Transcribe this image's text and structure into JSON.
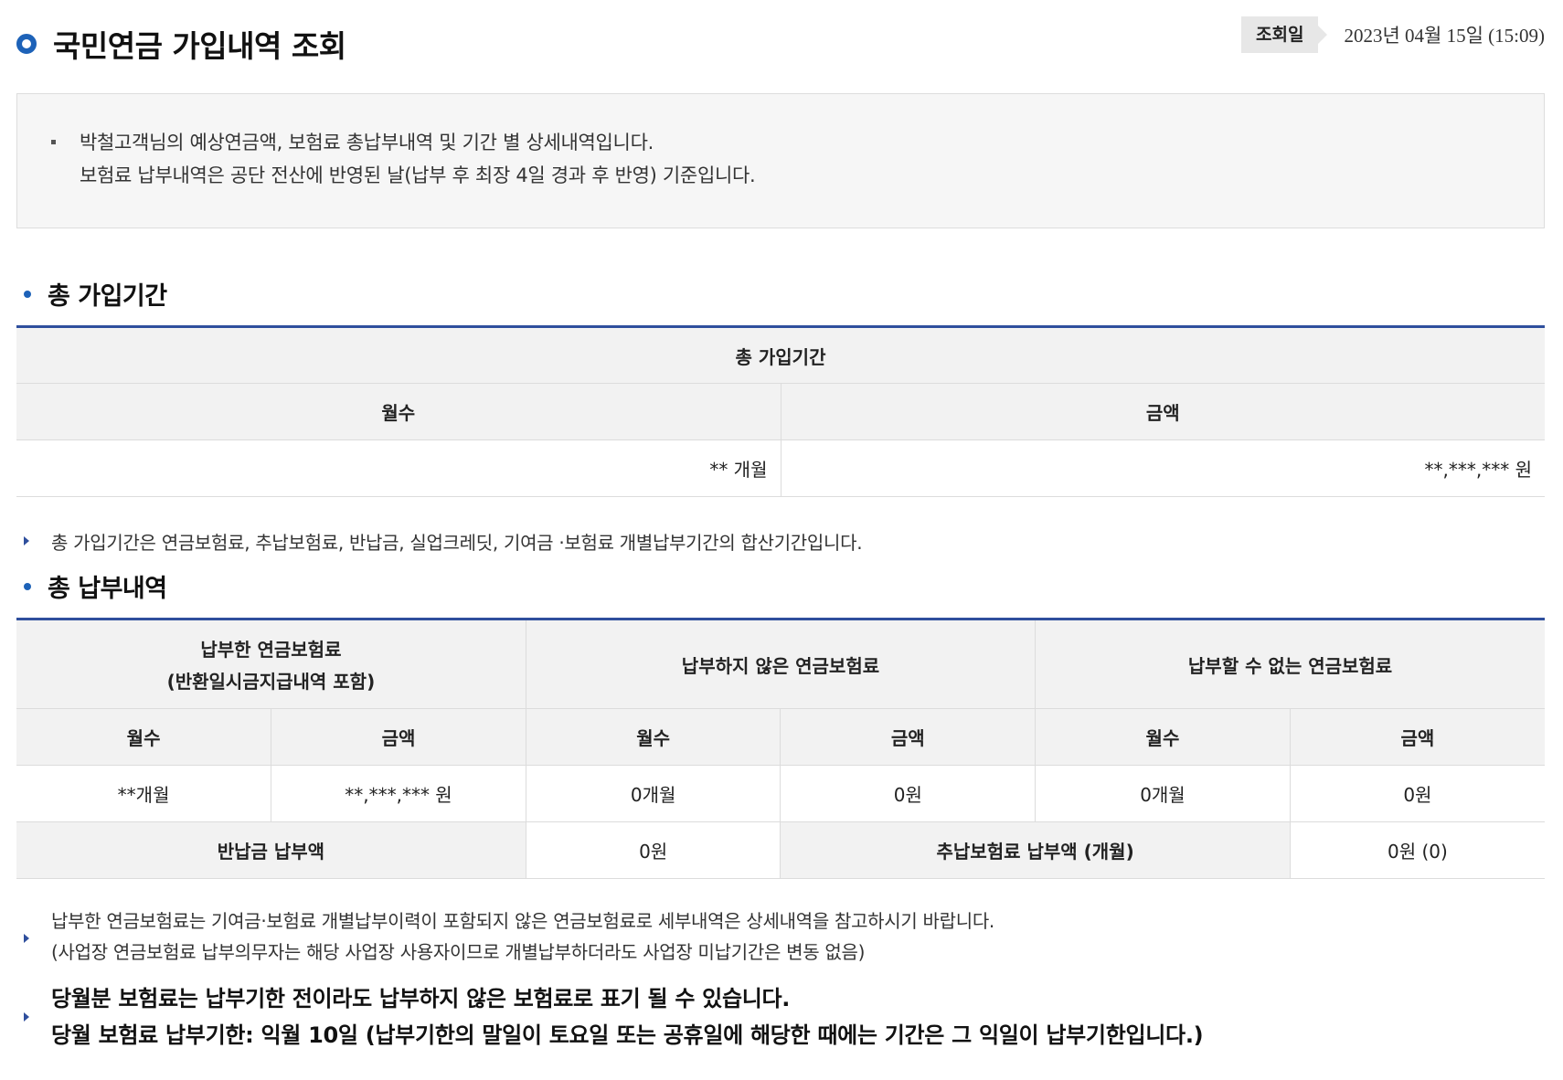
{
  "header": {
    "title": "국민연금 가입내역 조회",
    "query_label": "조회일",
    "query_value": "2023년 04월 15일 (15:09)"
  },
  "notice": {
    "lines": [
      "박철고객님의 예상연금액, 보험료 총납부내역 및 기간 별 상세내역입니다.",
      "보험료 납부내역은 공단 전산에 반영된 날(납부 후 최장 4일 경과 후 반영) 기준입니다."
    ]
  },
  "total_period": {
    "section_title": "총 가입기간",
    "table_header": "총 가입기간",
    "col_months": "월수",
    "col_amount": "금액",
    "months_value": "** 개월",
    "amount_value": "**,***,*** 원",
    "note": "총 가입기간은 연금보험료, 추납보험료, 반납금, 실업크레딧, 기여금 ·보험료 개별납부기간의 합산기간입니다."
  },
  "total_payment": {
    "section_title": "총 납부내역",
    "groups": [
      {
        "label_line1": "납부한 연금보험료",
        "label_line2": "(반환일시금지급내역 포함)"
      },
      {
        "label_line1": "납부하지 않은 연금보험료",
        "label_line2": ""
      },
      {
        "label_line1": "납부할 수 없는 연금보험료",
        "label_line2": ""
      }
    ],
    "sub_headers": [
      "월수",
      "금액",
      "월수",
      "금액",
      "월수",
      "금액"
    ],
    "values": [
      "**개월",
      "**,***,***  원",
      "0개월",
      "0원",
      "0개월",
      "0원"
    ],
    "refund_label": "반납금 납부액",
    "refund_value": "0원",
    "extra_label": "추납보험료 납부액 (개월)",
    "extra_value": "0원 (0)"
  },
  "footnotes": {
    "note1_line1": "납부한 연금보험료는 기여금·보험료 개별납부이력이 포함되지 않은 연금보험료로 세부내역은 상세내역을 참고하시기 바랍니다.",
    "note1_line2": "(사업장 연금보험료 납부의무자는 해당 사업장 사용자이므로 개별납부하더라도 사업장 미납기간은 변동 없음)",
    "note2_line1": "당월분 보험료는 납부기한 전이라도 납부하지 않은 보험료로 표기 될 수 있습니다.",
    "note2_line2": "당월 보험료 납부기한: 익월 10일 (납부기한의 말일이 토요일 또는 공휴일에 해당한 때에는 기간은 그 익일이 납부기한입니다.)"
  },
  "colors": {
    "accent": "#1d62b8",
    "table_top_border": "#2f4f9d",
    "header_bg": "#f2f2f2"
  }
}
